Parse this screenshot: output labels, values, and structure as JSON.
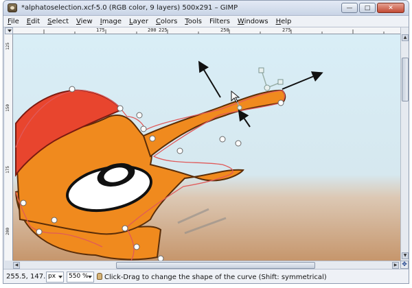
{
  "window": {
    "title": "*alphatoselection.xcf-5.0 (RGB color, 9 layers) 500x291 – GIMP",
    "buttons": {
      "minimize": "—",
      "maximize": "□",
      "close": "✕"
    }
  },
  "menubar": {
    "items": [
      {
        "label": "File",
        "accel": "F",
        "rest": "ile"
      },
      {
        "label": "Edit",
        "accel": "E",
        "rest": "dit"
      },
      {
        "label": "Select",
        "accel": "S",
        "rest": "elect"
      },
      {
        "label": "View",
        "accel": "V",
        "rest": "iew"
      },
      {
        "label": "Image",
        "accel": "I",
        "rest": "mage"
      },
      {
        "label": "Layer",
        "accel": "L",
        "rest": "ayer"
      },
      {
        "label": "Colors",
        "accel": "C",
        "rest": "olors"
      },
      {
        "label": "Tools",
        "accel": "T",
        "rest": "ools"
      },
      {
        "label": "Filters",
        "accel": "",
        "rest": "Filters"
      },
      {
        "label": "Windows",
        "accel": "W",
        "rest": "indows"
      },
      {
        "label": "Help",
        "accel": "H",
        "rest": "elp"
      }
    ]
  },
  "rulers": {
    "horizontal": [
      "175",
      "200",
      "225",
      "250",
      "275"
    ],
    "vertical": [
      "125",
      "150",
      "175",
      "200"
    ]
  },
  "statusbar": {
    "coords": "255.5, 147.6",
    "unit": "px",
    "zoom": "550 %",
    "message": "Click-Drag to change the shape of the curve (Shift: symmetrical)"
  },
  "colors": {
    "sky": "#d9eef7",
    "ground": "#c99a72",
    "body": "#f08a1e",
    "hat": "#e8452e",
    "path": "#e05a5a"
  }
}
